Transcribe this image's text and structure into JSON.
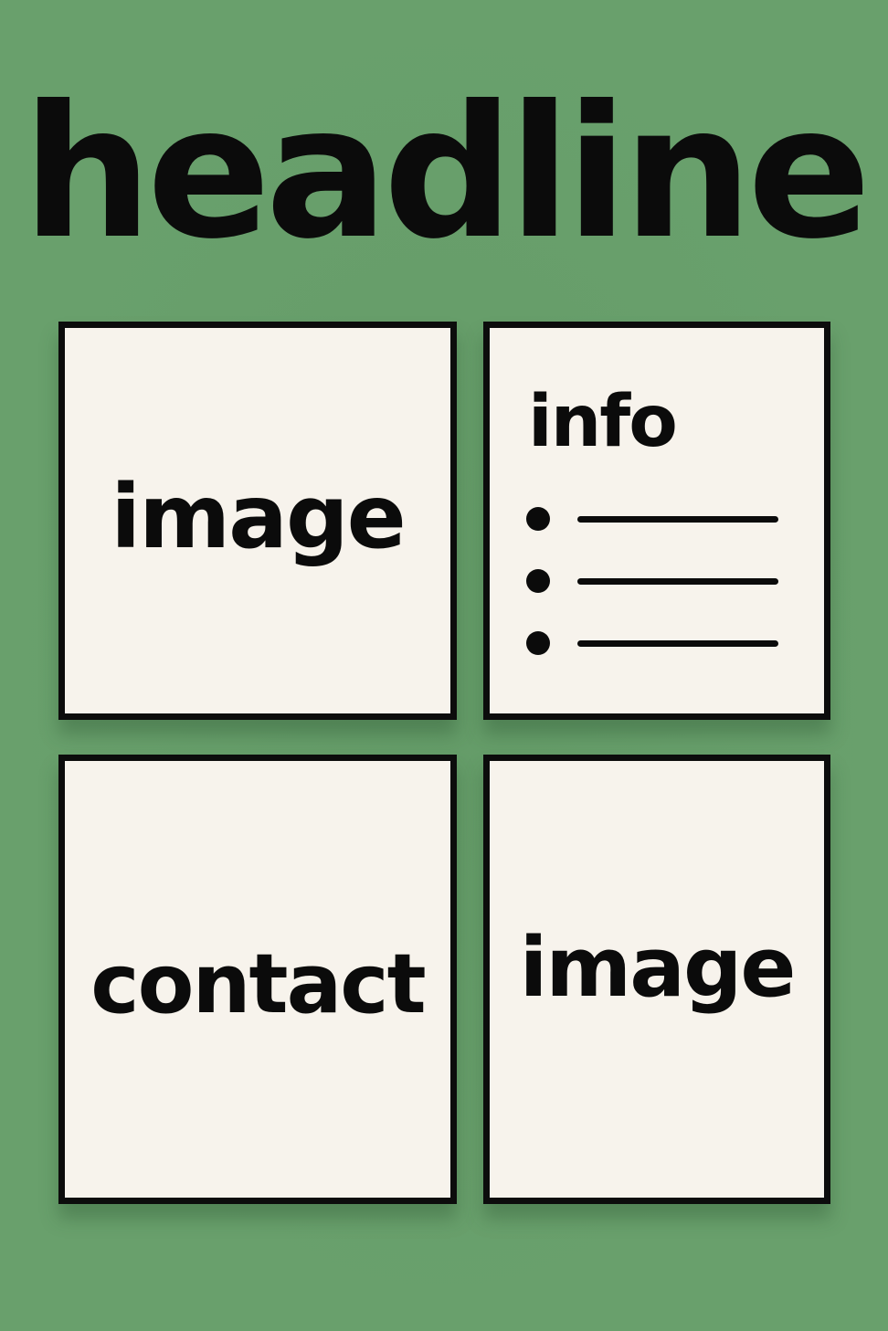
{
  "headline": "headline",
  "panels": [
    {
      "label": "image"
    },
    {
      "title": "info",
      "bullets": [
        "",
        "",
        ""
      ]
    },
    {
      "label": "contact"
    },
    {
      "label": "image"
    }
  ],
  "colors": {
    "background": "#69a06c",
    "panel": "#f7f3ec",
    "ink": "#0b0b0b"
  }
}
